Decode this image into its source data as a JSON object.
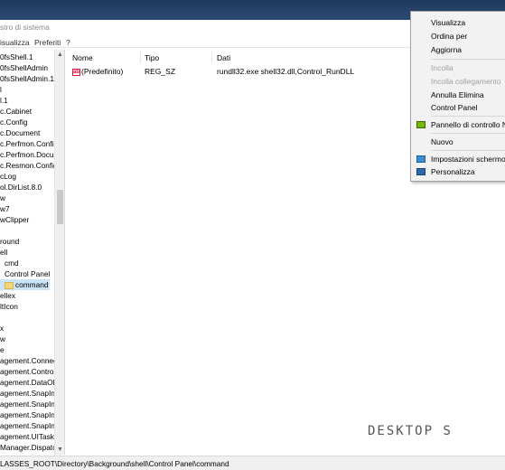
{
  "window": {
    "title": "stro di sistema"
  },
  "menubar": {
    "items": [
      "isualizza",
      "Preferiti",
      "?"
    ]
  },
  "tree": {
    "items": [
      {
        "label": "0fsShell.1"
      },
      {
        "label": "0fsShellAdmin"
      },
      {
        "label": "0fsShellAdmin.1"
      },
      {
        "label": "l"
      },
      {
        "label": "l.1"
      },
      {
        "label": "c.Cabinet"
      },
      {
        "label": "c.Config"
      },
      {
        "label": "c.Document"
      },
      {
        "label": "c.Perfmon.Config"
      },
      {
        "label": "c.Perfmon.Docum"
      },
      {
        "label": "c.Resmon.Config"
      },
      {
        "label": "cLog"
      },
      {
        "label": "ol.DirList.8.0"
      },
      {
        "label": "w"
      },
      {
        "label": "w7"
      },
      {
        "label": "wClipper"
      },
      {
        "label": ""
      },
      {
        "label": "round"
      },
      {
        "label": "ell"
      },
      {
        "label": "cmd"
      },
      {
        "label": "Control Panel"
      },
      {
        "label": "command"
      },
      {
        "label": "ellex"
      },
      {
        "label": "ltIcon"
      },
      {
        "label": ""
      },
      {
        "label": "x"
      },
      {
        "label": "w"
      },
      {
        "label": "e"
      },
      {
        "label": "agement.Connect"
      },
      {
        "label": "agement.Control"
      },
      {
        "label": "agement.DataObj"
      },
      {
        "label": "agement.SnapIn"
      },
      {
        "label": "agement.SnapInA"
      },
      {
        "label": "agement.SnapInC"
      },
      {
        "label": "agement.SnapInE"
      },
      {
        "label": "agement.UITasks"
      },
      {
        "label": "Manager.DispatchM"
      }
    ]
  },
  "values": {
    "columns": [
      "Nome",
      "Tipo",
      "Dati"
    ],
    "rows": [
      {
        "name": "(Predefinito)",
        "type": "REG_SZ",
        "data": "rundll32.exe shell32.dll,Control_RunDLL"
      }
    ]
  },
  "watermark": "DESKTOP S",
  "statusbar": {
    "path": "LASSES_ROOT\\Directory\\Background\\shell\\Control Panel\\command"
  },
  "context_menu": {
    "items": [
      {
        "label": "Visualizza",
        "disabled": false
      },
      {
        "label": "Ordina per",
        "disabled": false
      },
      {
        "label": "Aggiorna",
        "disabled": false
      },
      {
        "label": "Incolla",
        "disabled": true
      },
      {
        "label": "Incolla collegamento",
        "disabled": true
      },
      {
        "label": "Annulla Elimina",
        "disabled": false
      },
      {
        "label": "Control Panel",
        "disabled": false
      },
      {
        "label": "Pannello di controllo NVIDIA",
        "disabled": false,
        "icon": "nvidia-icon"
      },
      {
        "label": "Nuovo",
        "disabled": false
      },
      {
        "label": "Impostazioni schermo",
        "disabled": false,
        "icon": "display-settings-icon"
      },
      {
        "label": "Personalizza",
        "disabled": false,
        "icon": "personalize-icon"
      }
    ]
  }
}
